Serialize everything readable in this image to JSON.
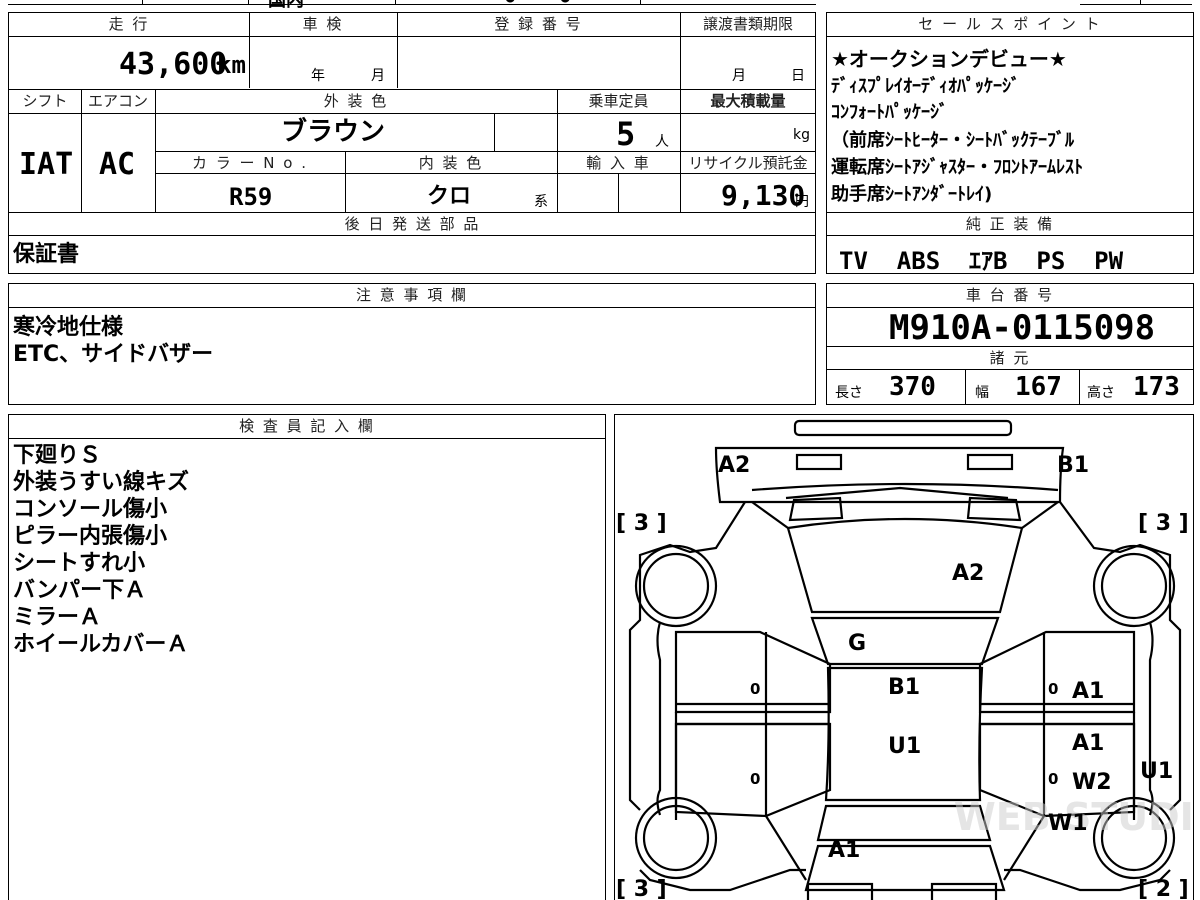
{
  "top_strip": {
    "fragment_1": "国内",
    "fragment_2": "●",
    "fragment_3": "●"
  },
  "vehicle": {
    "headers": {
      "mileage": "走 行",
      "inspection": "車 検",
      "registration": "登 録 番 号",
      "transfer_deadline": "譲渡書類期限",
      "shift": "シフト",
      "aircon": "エアコン",
      "exterior_color": "外 装 色",
      "capacity": "乗車定員",
      "max_load": "最大積載量",
      "color_no": "カ ラ ー N o .",
      "interior_color": "内 装 色",
      "import": "輸 入 車",
      "recycle_fee": "リサイクル預託金"
    },
    "mileage": "43,600",
    "mileage_unit": "km",
    "inspection_year": "年",
    "inspection_month": "月",
    "transfer_month": "月",
    "transfer_day": "日",
    "shift": "IAT",
    "aircon": "AC",
    "exterior_color": "ブラウン",
    "capacity": "5",
    "capacity_unit": "人",
    "max_load_unit": "kg",
    "color_no": "R59",
    "interior_color": "クロ",
    "interior_suffix": "系",
    "recycle_fee": "9,130",
    "recycle_unit": "円"
  },
  "sales_points": {
    "header": "セ ー ル ス ポ イ ン ト",
    "lines": [
      "★オークションデビュー★",
      "ﾃﾞｨｽﾌﾟﾚｲｵｰﾃﾞｨｵﾊﾟｯｹｰｼﾞ",
      "ｺﾝﾌｫｰﾄﾊﾟｯｹｰｼﾞ",
      "（前席ｼｰﾄﾋｰﾀｰ・ｼｰﾄﾊﾞｯｸﾃｰﾌﾞﾙ",
      "運転席ｼｰﾄｱｼﾞｬｽﾀｰ・ﾌﾛﾝﾄｱｰﾑﾚｽﾄ",
      "助手席ｼｰﾄｱﾝﾀﾞｰﾄﾚｲ)"
    ]
  },
  "later_parts": {
    "header": "後 日 発 送 部 品",
    "value": "保証書"
  },
  "genuine_equipment": {
    "header": "純 正 装 備",
    "value": "TV  ABS  ｴｱB  PS  PW"
  },
  "notes": {
    "header": "注 意 事 項 欄",
    "lines": [
      "寒冷地仕様",
      "ETC、サイドバザー"
    ]
  },
  "chassis": {
    "header": "車 台 番 号",
    "value": "M910A-0115098"
  },
  "specs": {
    "header": "諸 元",
    "length_label": "長さ",
    "length": "370",
    "width_label": "幅",
    "width": "167",
    "height_label": "高さ",
    "height": "173"
  },
  "inspector": {
    "header": "検 査 員 記 入 欄",
    "lines": [
      "下廻りＳ",
      "外装うすい線キズ",
      "コンソール傷小",
      "ピラー内張傷小",
      "シートすれ小",
      "バンパー下Ａ",
      "ミラーＡ",
      "ホイールカバーＡ"
    ]
  },
  "diagram": {
    "tires": {
      "front_left": "[ 3 ]",
      "front_right": "[ 3 ]",
      "rear_left": "[ 3 ]",
      "rear_right": "[ 2 ]"
    },
    "marks": {
      "front_left": "A2",
      "front_right": "B1",
      "hood": "A2",
      "windshield": "G",
      "roof_front": "B1",
      "roof_rear": "U1",
      "right_front_door": "A1",
      "right_rear_door": "A1",
      "right_rear_door_2": "W2",
      "right_fender": "U1",
      "right_quarter": "W1",
      "trunk": "A1",
      "door_zero_1": "0",
      "door_zero_2": "0",
      "door_zero_3": "0",
      "door_zero_4": "0"
    }
  },
  "watermark": "WEB STUDIO"
}
